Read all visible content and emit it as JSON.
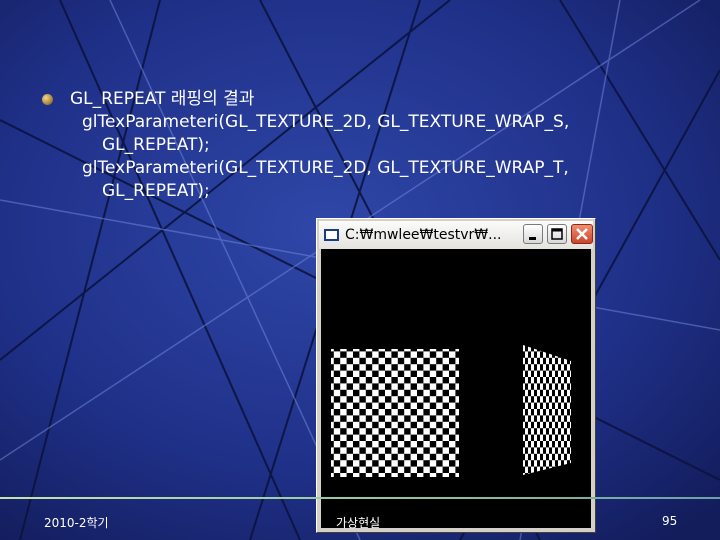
{
  "slide": {
    "bullet": "GL_REPEAT 래핑의 결과",
    "code_lines": [
      "glTexParameteri(GL_TEXTURE_2D, GL_TEXTURE_WRAP_S,",
      "GL_REPEAT);",
      "glTexParameteri(GL_TEXTURE_2D, GL_TEXTURE_WRAP_T,",
      "GL_REPEAT);"
    ]
  },
  "window": {
    "title": "C:₩mwlee₩testvr₩...",
    "icons": [
      "app-window-icon",
      "minimize-icon",
      "maximize-icon",
      "close-icon"
    ],
    "client_background": "#000000"
  },
  "footer": {
    "left": "2010-2학기",
    "center": "가상현실",
    "page": "95"
  },
  "colors": {
    "background": "#1c2c78",
    "close_button": "#d0573e",
    "checker_light": "#ffffff",
    "checker_dark": "#000000"
  }
}
